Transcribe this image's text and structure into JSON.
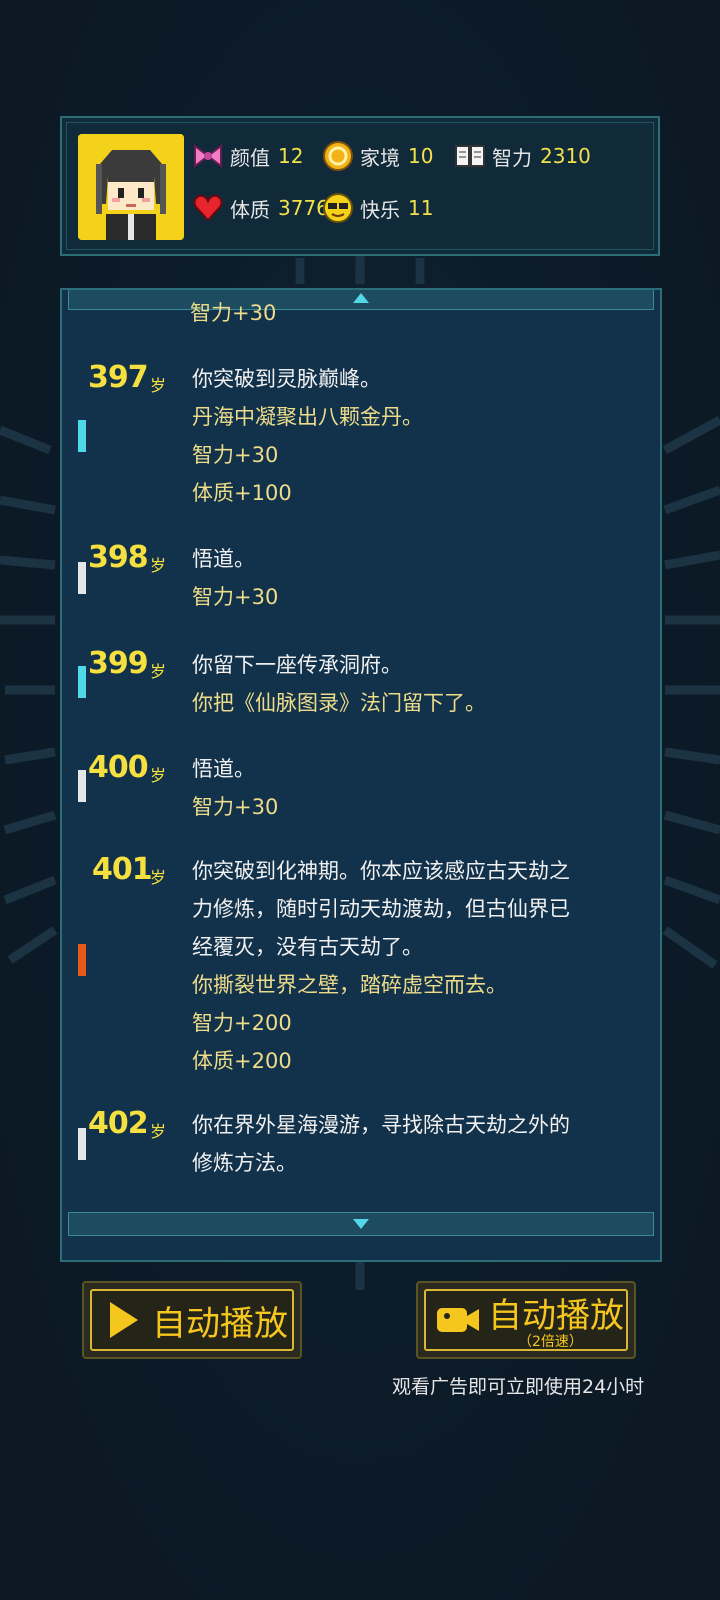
{
  "stats": {
    "items": [
      {
        "icon": "bow-icon",
        "label": "颜值",
        "value": "12"
      },
      {
        "icon": "coin-icon",
        "label": "家境",
        "value": "10"
      },
      {
        "icon": "book-icon",
        "label": "智力",
        "value": "2310"
      },
      {
        "icon": "heart-icon",
        "label": "体质",
        "value": "3776"
      },
      {
        "icon": "sunglasses-icon",
        "label": "快乐",
        "value": "11"
      }
    ]
  },
  "log": {
    "unit": "岁",
    "top_partial": "智力+30",
    "entries": [
      {
        "age": "397",
        "bar_color": "#4fd8e8",
        "lines": [
          {
            "text": "你突破到灵脉巅峰。",
            "type": "main"
          },
          {
            "text": "丹海中凝聚出八颗金丹。",
            "type": "sub"
          },
          {
            "text": "智力+30",
            "type": "sub"
          },
          {
            "text": "体质+100",
            "type": "sub"
          }
        ]
      },
      {
        "age": "398",
        "bar_color": "#e6e6e6",
        "lines": [
          {
            "text": "悟道。",
            "type": "main"
          },
          {
            "text": "智力+30",
            "type": "sub"
          }
        ]
      },
      {
        "age": "399",
        "bar_color": "#4fd8e8",
        "lines": [
          {
            "text": "你留下一座传承洞府。",
            "type": "main"
          },
          {
            "text": "你把《仙脉图录》法门留下了。",
            "type": "sub"
          }
        ]
      },
      {
        "age": "400",
        "bar_color": "#e6e6e6",
        "lines": [
          {
            "text": "悟道。",
            "type": "main"
          },
          {
            "text": "智力+30",
            "type": "sub"
          }
        ]
      },
      {
        "age": "401",
        "bar_color": "#e85a1a",
        "lines": [
          {
            "text": "你突破到化神期。你本应该感应古天劫之",
            "type": "main"
          },
          {
            "text": "力修炼，随时引动天劫渡劫，但古仙界已",
            "type": "main"
          },
          {
            "text": "经覆灭，没有古天劫了。",
            "type": "main"
          },
          {
            "text": "你撕裂世界之壁，踏碎虚空而去。",
            "type": "sub"
          },
          {
            "text": "智力+200",
            "type": "sub"
          },
          {
            "text": "体质+200",
            "type": "sub"
          }
        ]
      },
      {
        "age": "402",
        "bar_color": "#e6e6e6",
        "lines": [
          {
            "text": "你在界外星海漫游，寻找除古天劫之外的",
            "type": "main"
          },
          {
            "text": "修炼方法。",
            "type": "main"
          }
        ]
      }
    ]
  },
  "buttons": {
    "autoplay_label": "自动播放",
    "autoplay2x_label": "自动播放",
    "autoplay2x_sub": "（2倍速）",
    "ad_hint": "观看广告即可立即使用24小时"
  },
  "colors": {
    "accent": "#f5e040",
    "panel_bg": "#12314a",
    "panel_border": "#2b6e78",
    "button_gold": "#f5c61e"
  }
}
